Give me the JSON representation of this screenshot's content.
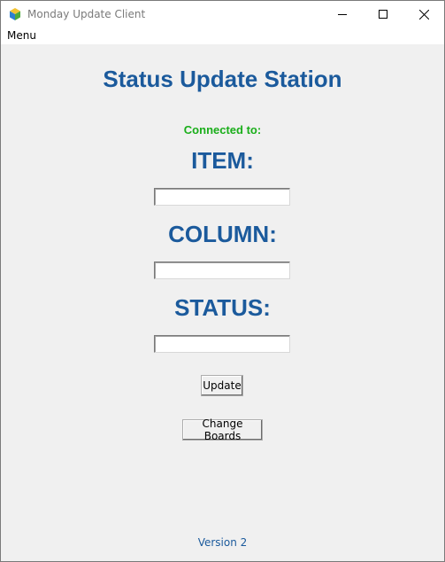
{
  "window": {
    "title": "Monday Update Client",
    "icon": "cube-app-icon",
    "controls": [
      "minimize-icon",
      "maximize-icon",
      "close-icon"
    ]
  },
  "menubar": {
    "menu_label": "Menu"
  },
  "main": {
    "title": "Status Update Station",
    "connected_label": "Connected to:",
    "item_label": "ITEM:",
    "item_value": "",
    "column_label": "COLUMN:",
    "column_value": "",
    "status_label": "STATUS:",
    "status_value": "",
    "update_button": "Update",
    "change_boards_button": "Change Boards",
    "version": "Version 2"
  },
  "colors": {
    "title_blue": "#1b5a9c",
    "connected_green": "#1aae1a",
    "window_bg": "#f0f0f0"
  }
}
